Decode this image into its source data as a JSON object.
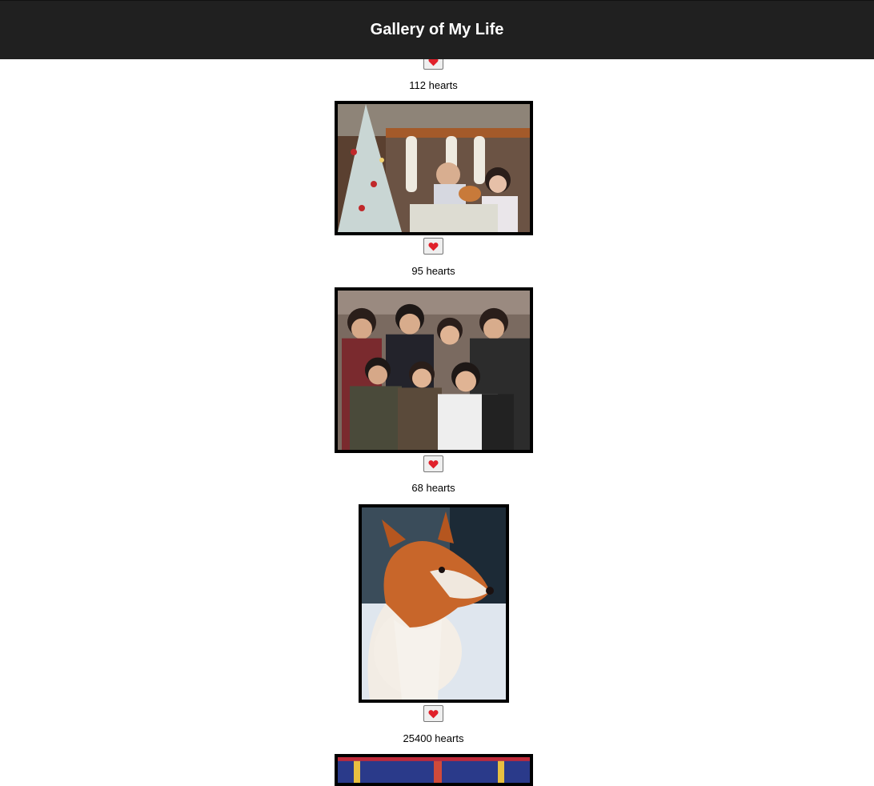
{
  "header": {
    "title": "Gallery of My Life"
  },
  "heart_icon_color": "#e0202a",
  "posts": [
    {
      "hearts": "112 hearts"
    },
    {
      "hearts": "95 hearts",
      "photo": "family-christmas-photo"
    },
    {
      "hearts": "68 hearts",
      "photo": "friends-group-photo"
    },
    {
      "hearts": "25400 hearts",
      "photo": "corgi-snow-photo"
    },
    {
      "photo": "carnival-photo"
    }
  ]
}
